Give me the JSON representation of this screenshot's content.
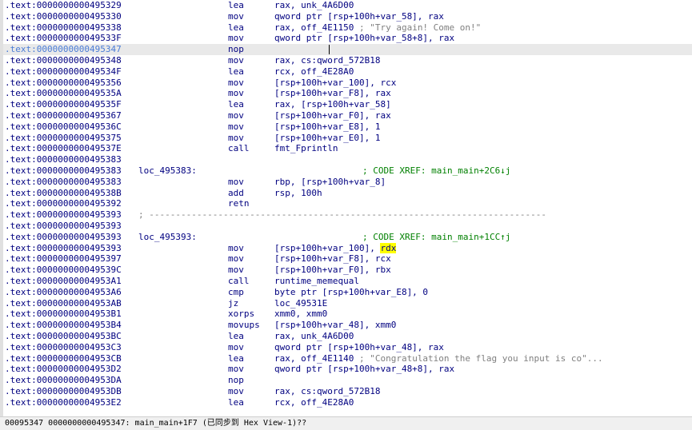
{
  "disassembly": {
    "lines": [
      {
        "addr": ".text:0000000000495329",
        "mnem": "lea",
        "ops": "rax, unk_4A6D00"
      },
      {
        "addr": ".text:0000000000495330",
        "mnem": "mov",
        "ops": "qword ptr [rsp+100h+var_58], rax"
      },
      {
        "addr": ".text:0000000000495338",
        "mnem": "lea",
        "ops": "rax, off_4E1150",
        "comment": " ; \"Try again! Come on!\""
      },
      {
        "addr": ".text:000000000049533F",
        "mnem": "mov",
        "ops": "qword ptr [rsp+100h+var_58+8], rax"
      },
      {
        "addr": ".text:0000000000495347",
        "mnem": "nop",
        "selected": true
      },
      {
        "addr": ".text:0000000000495348",
        "mnem": "mov",
        "ops": "rax, cs:qword_572B18"
      },
      {
        "addr": ".text:000000000049534F",
        "mnem": "lea",
        "ops": "rcx, off_4E28A0"
      },
      {
        "addr": ".text:0000000000495356",
        "mnem": "mov",
        "ops": "[rsp+100h+var_100], rcx"
      },
      {
        "addr": ".text:000000000049535A",
        "mnem": "mov",
        "ops": "[rsp+100h+var_F8], rax"
      },
      {
        "addr": ".text:000000000049535F",
        "mnem": "lea",
        "ops": "rax, [rsp+100h+var_58]"
      },
      {
        "addr": ".text:0000000000495367",
        "mnem": "mov",
        "ops": "[rsp+100h+var_F0], rax"
      },
      {
        "addr": ".text:000000000049536C",
        "mnem": "mov",
        "ops": "[rsp+100h+var_E8], 1"
      },
      {
        "addr": ".text:0000000000495375",
        "mnem": "mov",
        "ops": "[rsp+100h+var_E0], 1"
      },
      {
        "addr": ".text:000000000049537E",
        "mnem": "call",
        "ops": "fmt_Fprintln"
      },
      {
        "addr": ".text:0000000000495383"
      },
      {
        "addr": ".text:0000000000495383",
        "label": "loc_495383:",
        "xref": "; CODE XREF: main_main+2C6↓j"
      },
      {
        "addr": ".text:0000000000495383",
        "mnem": "mov",
        "ops": "rbp, [rsp+100h+var_8]"
      },
      {
        "addr": ".text:000000000049538B",
        "mnem": "add",
        "ops": "rsp, 100h"
      },
      {
        "addr": ".text:0000000000495392",
        "mnem": "retn"
      },
      {
        "addr": ".text:0000000000495393",
        "separator": "; ---------------------------------------------------------------------------"
      },
      {
        "addr": ".text:0000000000495393"
      },
      {
        "addr": ".text:0000000000495393",
        "label": "loc_495393:",
        "xref": "; CODE XREF: main_main+1CC↑j"
      },
      {
        "addr": ".text:0000000000495393",
        "mnem": "mov",
        "ops": "[rsp+100h+var_100], ",
        "ops_hl": "rdx"
      },
      {
        "addr": ".text:0000000000495397",
        "mnem": "mov",
        "ops": "[rsp+100h+var_F8], rcx"
      },
      {
        "addr": ".text:000000000049539C",
        "mnem": "mov",
        "ops": "[rsp+100h+var_F0], rbx"
      },
      {
        "addr": ".text:00000000004953A1",
        "mnem": "call",
        "ops": "runtime_memequal"
      },
      {
        "addr": ".text:00000000004953A6",
        "mnem": "cmp",
        "ops": "byte ptr [rsp+100h+var_E8], 0"
      },
      {
        "addr": ".text:00000000004953AB",
        "mnem": "jz",
        "ops": "loc_49531E"
      },
      {
        "addr": ".text:00000000004953B1",
        "mnem": "xorps",
        "ops": "xmm0, xmm0"
      },
      {
        "addr": ".text:00000000004953B4",
        "mnem": "movups",
        "ops": "[rsp+100h+var_48], xmm0"
      },
      {
        "addr": ".text:00000000004953BC",
        "mnem": "lea",
        "ops": "rax, unk_4A6D00"
      },
      {
        "addr": ".text:00000000004953C3",
        "mnem": "mov",
        "ops": "qword ptr [rsp+100h+var_48], rax"
      },
      {
        "addr": ".text:00000000004953CB",
        "mnem": "lea",
        "ops": "rax, off_4E1140",
        "comment": " ; \"Congratulation the flag you input is co\"..."
      },
      {
        "addr": ".text:00000000004953D2",
        "mnem": "mov",
        "ops": "qword ptr [rsp+100h+var_48+8], rax"
      },
      {
        "addr": ".text:00000000004953DA",
        "mnem": "nop"
      },
      {
        "addr": ".text:00000000004953DB",
        "mnem": "mov",
        "ops": "rax, cs:qword_572B18"
      },
      {
        "addr": ".text:00000000004953E2",
        "mnem": "lea",
        "ops": "rcx, off_4E28A0"
      }
    ]
  },
  "status_bar": {
    "text": "00095347 0000000000495347: main_main+1F7 (已同步到 Hex View-1)??"
  },
  "colors": {
    "address": "#000080",
    "selected_address": "#4a7cd6",
    "xref": "#008000",
    "comment": "#7f7f7f",
    "highlight": "#ffff00",
    "selected_line": "#e9e9e9"
  }
}
